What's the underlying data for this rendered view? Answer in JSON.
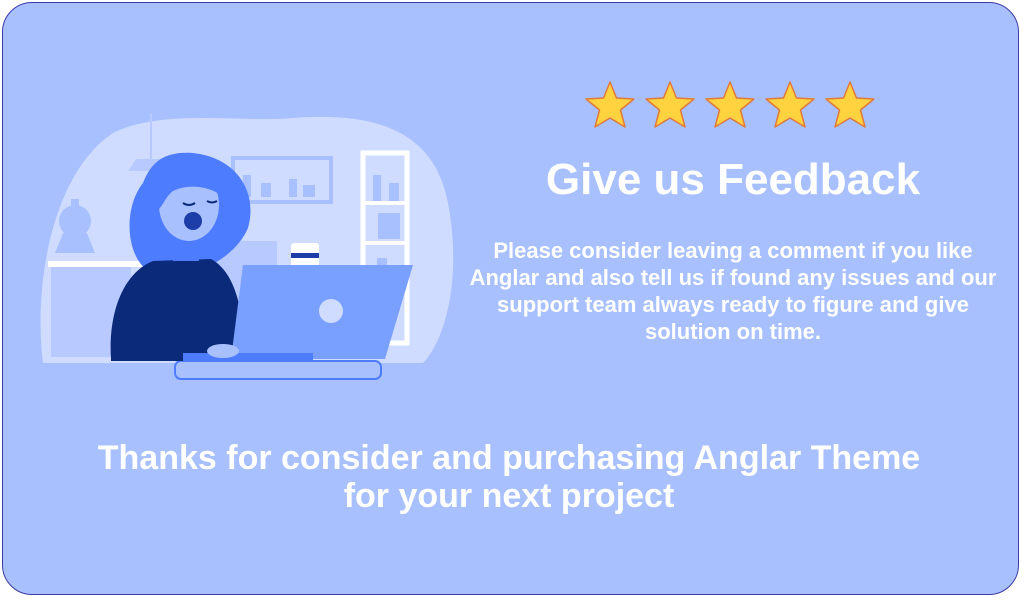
{
  "feedback": {
    "rating": 5,
    "rating_max": 5,
    "title": "Give us Feedback",
    "description": "Please consider leaving a comment if you like Anglar and also tell us if found any issues and our support team always ready to figure and give solution on time.",
    "thanks_line_1": "Thanks for consider and purchasing Anglar Theme",
    "thanks_line_2": "for your next project"
  },
  "icons": {
    "star": "star-icon",
    "illustration": "woman-working-on-laptop-illustration"
  },
  "colors": {
    "background": "#a9c0ff",
    "border": "#3a3aa8",
    "text": "#ffffff",
    "star_fill": "#ffd23f",
    "star_stroke": "#e07a3a",
    "illustration_dark": "#0b2b7a",
    "illustration_mid": "#4d7cff",
    "illustration_light": "#cfdcff"
  }
}
